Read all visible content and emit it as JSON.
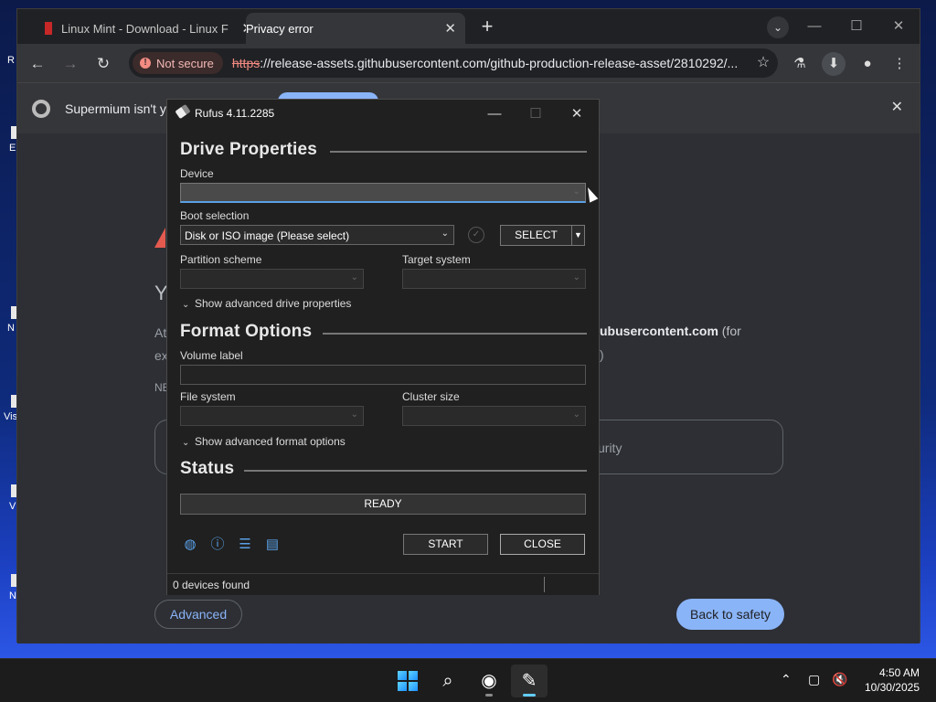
{
  "desktop": {
    "icons": [
      {
        "label": "R"
      },
      {
        "label": "E"
      },
      {
        "label": "N"
      },
      {
        "label": "Vis"
      },
      {
        "label": "V"
      },
      {
        "label": "N"
      }
    ]
  },
  "browser": {
    "tabs": [
      {
        "title": "Linux Mint - Download - Linux F"
      },
      {
        "title": "Privacy error"
      }
    ],
    "new_tab_glyph": "+",
    "security_chip": "Not secure",
    "url_scheme": "https",
    "url_rest": "://release-assets.githubusercontent.com/github-production-release-asset/2810292/...",
    "infobar_message": "Supermium isn't yo",
    "page": {
      "heading_fragment": "Yo",
      "line1_fragment": "At",
      "line2_fragment": "ex",
      "line3_fragment": "NE",
      "host_bold": "ubusercontent.com",
      "host_suffix": " (for",
      "paren_fragment": ")",
      "box_fragment": "urity",
      "advanced_label": "Advanced",
      "back_label": "Back to safety"
    }
  },
  "rufus": {
    "title": "Rufus 4.11.2285",
    "drive_properties": "Drive Properties",
    "device_label": "Device",
    "device_value": "",
    "boot_selection_label": "Boot selection",
    "boot_selection_value": "Disk or ISO image (Please select)",
    "select_button": "SELECT",
    "partition_scheme_label": "Partition scheme",
    "target_system_label": "Target system",
    "advanced_drive": "Show advanced drive properties",
    "format_options": "Format Options",
    "volume_label_label": "Volume label",
    "volume_label_value": "",
    "file_system_label": "File system",
    "cluster_size_label": "Cluster size",
    "advanced_format": "Show advanced format options",
    "status_heading": "Status",
    "progress_text": "READY",
    "progress_fraction": 0,
    "start_button": "START",
    "close_button": "CLOSE",
    "status_bar": "0 devices found"
  },
  "taskbar": {
    "time": "4:50 AM",
    "date": "10/30/2025"
  },
  "colors": {
    "accent": "#8ab4f8",
    "rufus_focus": "#5aa0e6",
    "not_secure": "#f28b82"
  }
}
